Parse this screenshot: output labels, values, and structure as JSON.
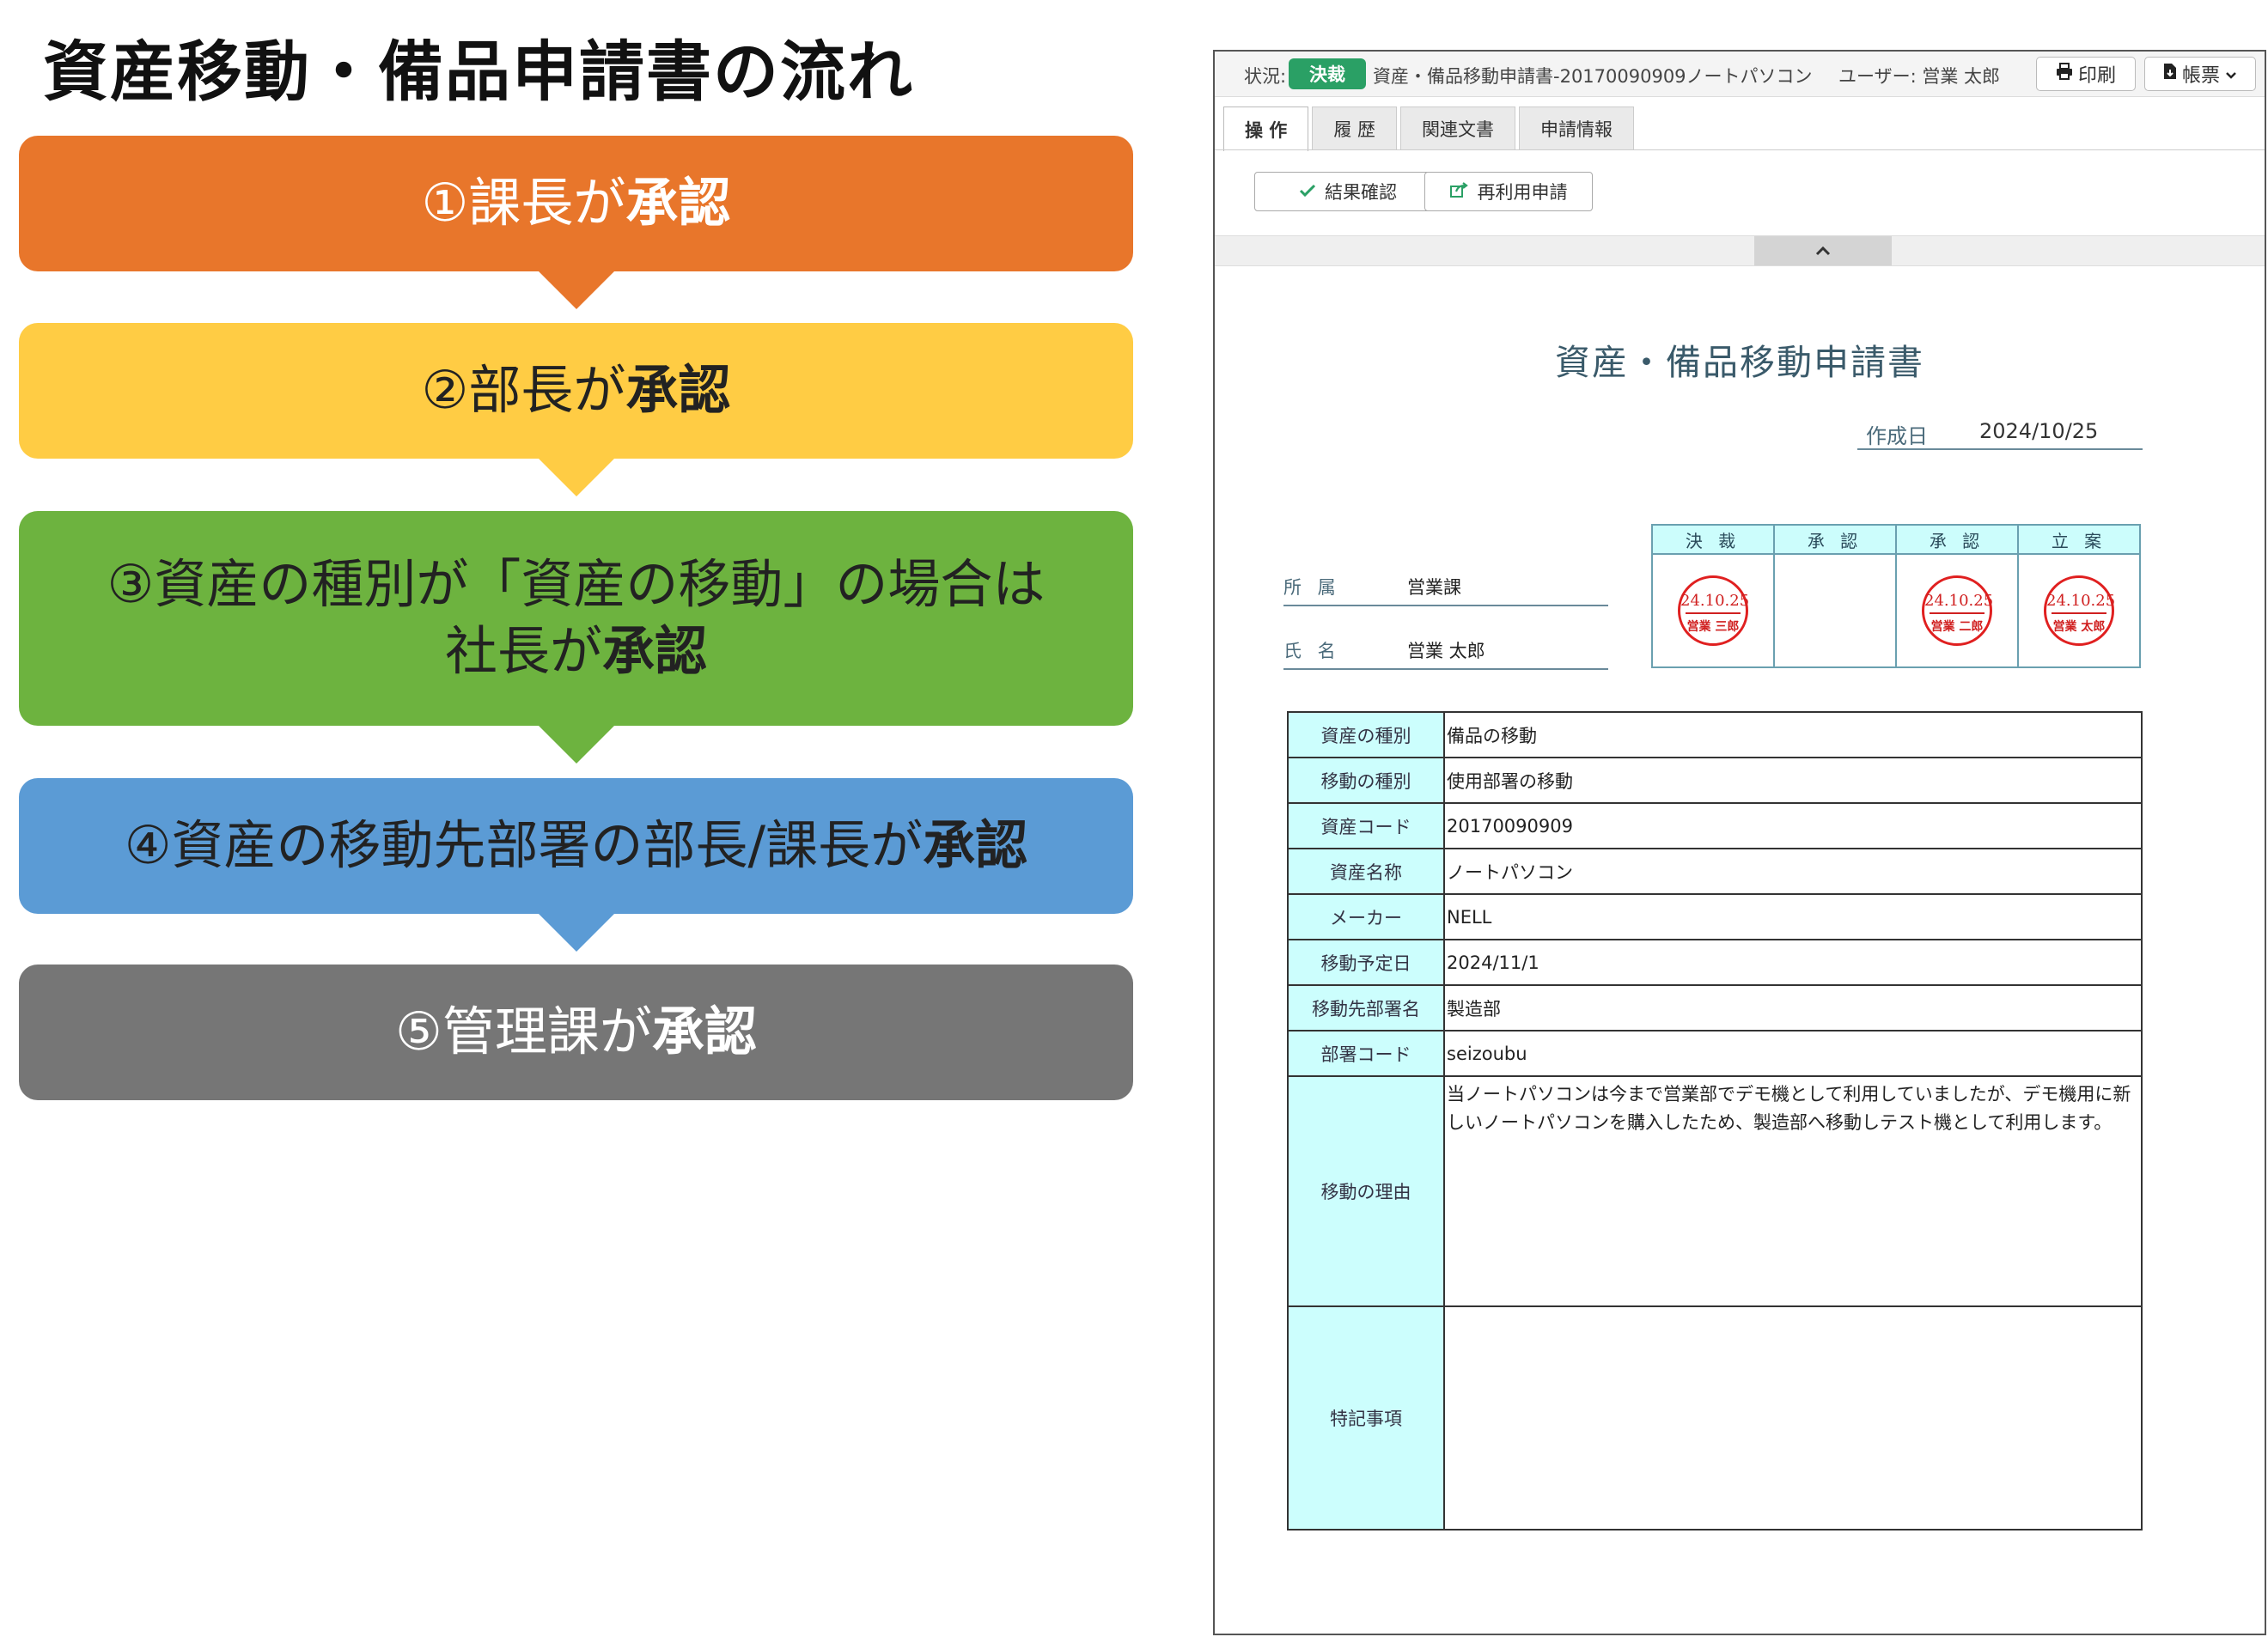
{
  "flow": {
    "title": "資産移動・備品申請書の流れ",
    "steps": [
      {
        "text": "①課長が",
        "strong": "承認",
        "color": "#e8762b"
      },
      {
        "text": "②部長が",
        "strong": "承認",
        "color": "#ffcc44"
      },
      {
        "line1": "③資産の種別が「資産の移動」の場合は",
        "text": "社長が",
        "strong": "承認",
        "color": "#6db33f"
      },
      {
        "text": "④資産の移動先部署の部長/課長が",
        "strong": "承認",
        "color": "#5b9bd5"
      },
      {
        "text": "⑤管理課が",
        "strong": "承認",
        "color": "#767676"
      }
    ]
  },
  "app": {
    "status_label": "状況:",
    "status_badge": "決裁",
    "doc_title": "資産・備品移動申請書-20170090909ノートパソコン",
    "user": "ユーザー: 営業 太郎",
    "print_label": "印刷",
    "forms_label": "帳票",
    "tabs": [
      "操 作",
      "履 歴",
      "関連文書",
      "申請情報"
    ],
    "result_button": "結果確認",
    "reuse_button": "再利用申請"
  },
  "form": {
    "title": "資産・備品移動申請書",
    "created_label": "作成日",
    "created_value": "2024/10/25",
    "dept_label": "所 属",
    "dept_value": "営業課",
    "name_label": "氏 名",
    "name_value": "営業 太郎",
    "stamp_headers": [
      "決 裁",
      "承 認",
      "承 認",
      "立 案"
    ],
    "seals": [
      {
        "date": "24.10.25",
        "name": "営業 三郎"
      },
      null,
      {
        "date": "24.10.25",
        "name": "営業 二郎"
      },
      {
        "date": "24.10.25",
        "name": "営業 太郎"
      }
    ],
    "rows": [
      {
        "key": "資産の種別",
        "value": "備品の移動"
      },
      {
        "key": "移動の種別",
        "value": "使用部署の移動"
      },
      {
        "key": "資産コード",
        "value": "20170090909"
      },
      {
        "key": "資産名称",
        "value": "ノートパソコン"
      },
      {
        "key": "メーカー",
        "value": "NELL"
      },
      {
        "key": "移動予定日",
        "value": "2024/11/1"
      },
      {
        "key": "移動先部署名",
        "value": "製造部"
      },
      {
        "key": "部署コード",
        "value": "seizoubu"
      }
    ],
    "reason_key": "移動の理由",
    "reason_value": "当ノートパソコンは今まで営業部でデモ機として利用していましたが、デモ機用に新しいノートパソコンを購入したため、製造部へ移動しテスト機として利用します。",
    "notes_key": "特記事項",
    "notes_value": ""
  }
}
